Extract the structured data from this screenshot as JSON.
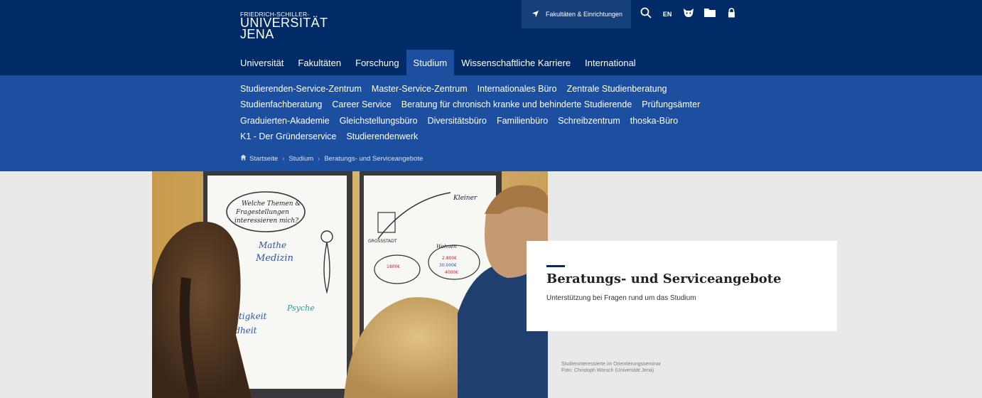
{
  "logo": {
    "line1": "FRIEDRICH-SCHILLER-",
    "line2": "UNIVERSITÄT",
    "line3": "JENA"
  },
  "utility": {
    "faculties_label": "Fakultäten & Einrichtungen",
    "lang_label": "EN",
    "icons": [
      "location-arrow-icon",
      "search-icon",
      "cat-icon",
      "folder-icon",
      "lock-icon"
    ]
  },
  "main_nav": [
    {
      "label": "Universität",
      "active": false
    },
    {
      "label": "Fakultäten",
      "active": false
    },
    {
      "label": "Forschung",
      "active": false
    },
    {
      "label": "Studium",
      "active": true
    },
    {
      "label": "Wissenschaftliche Karriere",
      "active": false
    },
    {
      "label": "International",
      "active": false
    }
  ],
  "sub_nav": {
    "row1": [
      "Studierenden-Service-Zentrum",
      "Master-Service-Zentrum",
      "Internationales Büro",
      "Zentrale Studienberatung"
    ],
    "row2": [
      "Studienfachberatung",
      "Career Service",
      "Beratung für chronisch kranke und behinderte Studierende",
      "Prüfungsämter"
    ],
    "row3": [
      "Graduierten-Akademie",
      "Gleichstellungsbüro",
      "Diversitätsbüro",
      "Familienbüro",
      "Schreibzentrum",
      "thoska-Büro"
    ],
    "row4": [
      "K1 - Der Gründerservice",
      "Studierendenwerk"
    ]
  },
  "breadcrumb": [
    "Startseite",
    "Studium",
    "Beratungs- und Serviceangebote"
  ],
  "hero": {
    "title": "Beratungs- und Serviceangebote",
    "subtitle": "Unterstützung bei Fragen rund um das Studium",
    "caption_line1": "Studieninteressierte im Orientierungsseminar",
    "caption_line2": "Foto: Christoph Worsch (Universität Jena)"
  },
  "photo_board": {
    "left_words": [
      "Welche Themen &",
      "Fragestellungen",
      "interessieren mich?",
      "Mathe",
      "Medizin",
      "Psyche",
      "Gerechtigkeit",
      "Gesundheit"
    ],
    "right_words": [
      "Kleiner",
      "GROSSSTADT",
      "Wohnen",
      "1800€",
      "2.800€",
      "30.000€",
      "4000€"
    ]
  },
  "colors": {
    "header": "#002b66",
    "subnav": "#1c4fa0",
    "util_btn": "#17407a"
  }
}
